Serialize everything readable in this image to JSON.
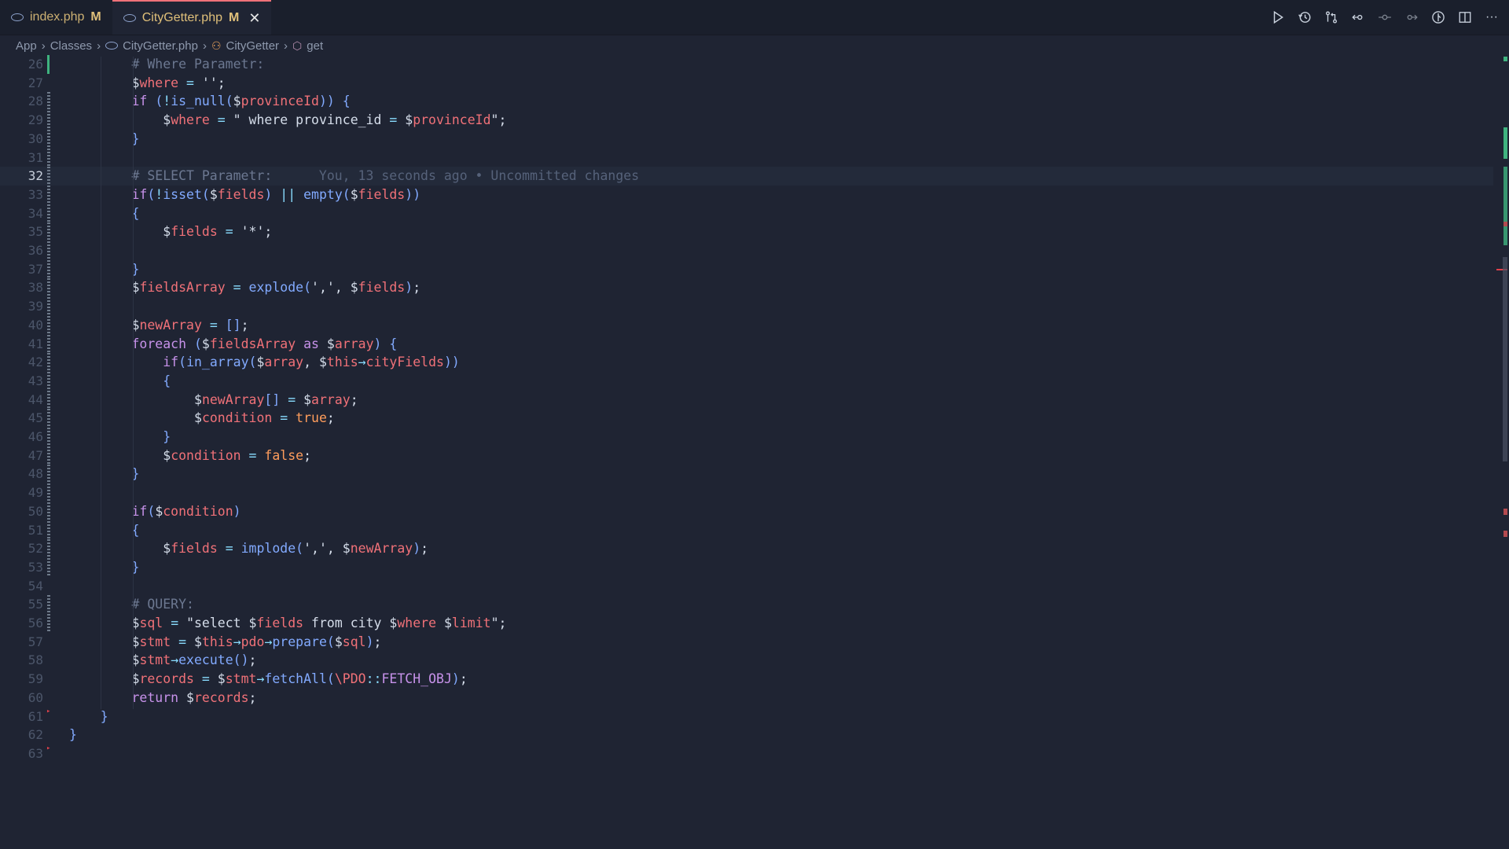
{
  "tabs": [
    {
      "name": "index.php",
      "status": "M",
      "active": false
    },
    {
      "name": "CityGetter.php",
      "status": "M",
      "active": true,
      "close": "✕"
    }
  ],
  "toolbar": {
    "icons": [
      "run-icon",
      "history-icon",
      "compare-icon",
      "revert-icon",
      "previous-change-icon",
      "next-change-icon",
      "git-lens-icon",
      "split-editor-icon",
      "more-actions-icon"
    ],
    "more_label": "···"
  },
  "breadcrumb": {
    "items": [
      "App",
      "Classes",
      "CityGetter.php",
      "CityGetter",
      "get"
    ]
  },
  "editor": {
    "current_line": "32",
    "blame": "You, 13 seconds ago • Uncommitted changes",
    "line_numbers": [
      "26",
      "27",
      "28",
      "29",
      "30",
      "31",
      "32",
      "33",
      "34",
      "35",
      "36",
      "37",
      "38",
      "39",
      "40",
      "41",
      "42",
      "43",
      "44",
      "45",
      "46",
      "47",
      "48",
      "49",
      "50",
      "51",
      "52",
      "53",
      "54",
      "55",
      "56",
      "57",
      "58",
      "59",
      "60",
      "61",
      "62",
      "63"
    ],
    "lines": [
      "        # Where Parametr:",
      "        $where = '';",
      "        if (!is_null($provinceId)) {",
      "            $where = \" where province_id = $provinceId\";",
      "        }",
      "",
      "        # SELECT Parametr:",
      "        if(!isset($fields) || empty($fields))",
      "        {",
      "            $fields = '*';",
      "",
      "        }",
      "        $fieldsArray = explode(',', $fields);",
      "",
      "        $newArray = [];",
      "        foreach ($fieldsArray as $array) {",
      "            if(in_array($array, $this→cityFields))",
      "            {",
      "                $newArray[] = $array;",
      "                $condition = true;",
      "            }",
      "            $condition = false;",
      "        }",
      "",
      "        if($condition)",
      "        {",
      "            $fields = implode(',', $newArray);",
      "        }",
      "",
      "        # QUERY:",
      "        $sql = \"select $fields from city $where $limit\";",
      "        $stmt = $this→pdo→prepare($sql);",
      "        $stmt→execute();",
      "        $records = $stmt→fetchAll(\\PDO::FETCH_OBJ);",
      "        return $records;",
      "    }",
      "}",
      ""
    ]
  },
  "colors": {
    "background": "#1f2433",
    "accent_tab": "#f07178",
    "added": "#3fb37f",
    "deleted": "#e0414b"
  }
}
